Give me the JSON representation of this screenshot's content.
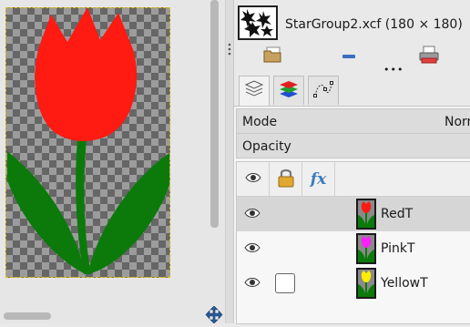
{
  "image_window": {
    "title": "StarGroup2.xcf (180 × 180)"
  },
  "canvas": {
    "flower_colors": {
      "petals": "#ff1a12",
      "stem": "#0b7a0b"
    }
  },
  "toolbar": {
    "buttons": [
      {
        "name": "open-image-button",
        "icon": "folder-icon"
      },
      {
        "name": "close-image-button",
        "icon": "minus-icon"
      },
      {
        "name": "print-button",
        "icon": "printer-icon"
      }
    ],
    "more_label": "•••"
  },
  "tabs": [
    {
      "name": "layers",
      "icon": "layers-icon",
      "active": true
    },
    {
      "name": "channels",
      "icon": "channels-icon",
      "active": false
    },
    {
      "name": "paths",
      "icon": "paths-icon",
      "active": false
    }
  ],
  "layers_panel": {
    "mode_label": "Mode",
    "mode_value": "Norm",
    "opacity_label": "Opacity",
    "header": {
      "visibility_icon": "eye-icon",
      "lock_icon": "lock-icon",
      "effects_label": "fx"
    },
    "layers": [
      {
        "name": "RedT",
        "color": "#ff1a12",
        "visible": true,
        "selected": true,
        "linked_box": false
      },
      {
        "name": "PinkT",
        "color": "#ff20ff",
        "visible": true,
        "selected": false,
        "linked_box": false
      },
      {
        "name": "YellowT",
        "color": "#ffee00",
        "visible": true,
        "selected": false,
        "linked_box": true
      }
    ]
  }
}
